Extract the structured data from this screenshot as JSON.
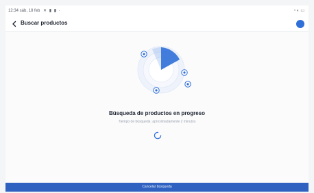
{
  "status_bar": {
    "time_date": "12:34 sáb, 18 feb",
    "icons_left": "✕ ▮ ▮ ·",
    "icons_right": "◔ ◐ ▭"
  },
  "app_bar": {
    "title": "Buscar productos"
  },
  "main": {
    "progress_title": "Búsqueda de productos en progreso",
    "subtitle": "Tiempo de búsqueda: aproximadamente 2 minutos"
  },
  "actions": {
    "cancel_label": "Cancelar búsqueda"
  },
  "colors": {
    "accent": "#2f62c0",
    "radar": "#2f6fd8",
    "ring_light": "#e9f0fb",
    "ring_border": "#dfe7f6"
  }
}
